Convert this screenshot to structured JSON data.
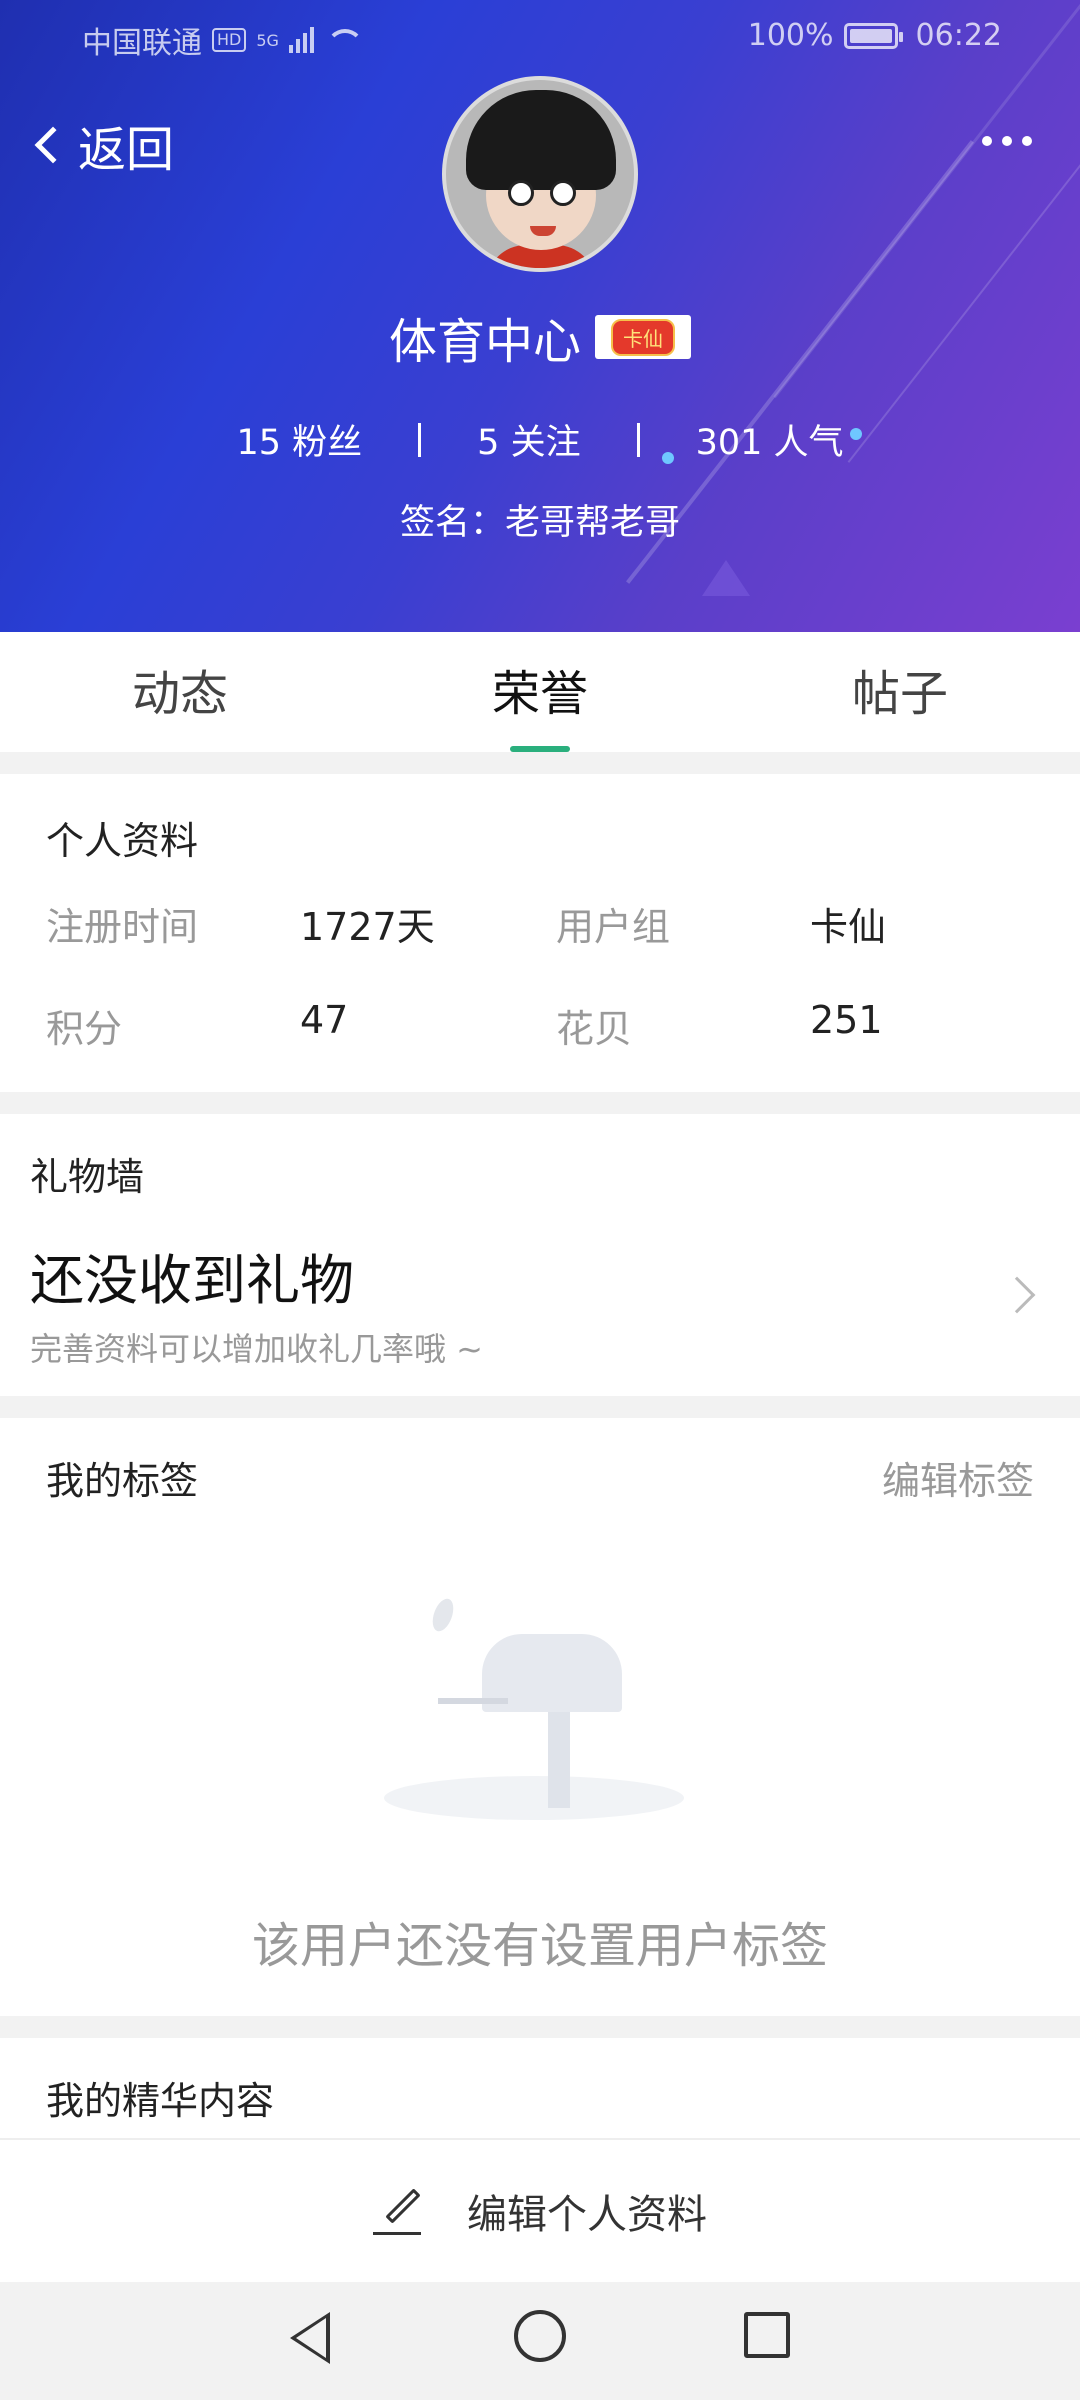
{
  "status_bar": {
    "carrier": "中国联通",
    "hd": "HD",
    "network": "5G",
    "battery": "100%",
    "time": "06:22"
  },
  "header": {
    "back_label": "返回",
    "username": "体育中心",
    "badge": "卡仙",
    "stats": [
      {
        "value": "15",
        "label": "粉丝"
      },
      {
        "value": "5",
        "label": "关注"
      },
      {
        "value": "301",
        "label": "人气"
      }
    ],
    "signature_label": "签名：",
    "signature": "老哥帮老哥",
    "accent_color": "#2a3fd6"
  },
  "tabs": [
    {
      "label": "动态",
      "active": false
    },
    {
      "label": "荣誉",
      "active": true
    },
    {
      "label": "帖子",
      "active": false
    }
  ],
  "profile": {
    "title": "个人资料",
    "fields": [
      {
        "label": "注册时间",
        "value": "1727天"
      },
      {
        "label": "用户组",
        "value": "卡仙"
      },
      {
        "label": "积分",
        "value": "47"
      },
      {
        "label": "花贝",
        "value": "251"
      }
    ]
  },
  "gift_wall": {
    "title": "礼物墙",
    "empty_title": "还没收到礼物",
    "hint": "完善资料可以增加收礼几率哦 ~"
  },
  "tags": {
    "title": "我的标签",
    "edit_label": "编辑标签",
    "empty_text": "该用户还没有设置用户标签"
  },
  "essence": {
    "title": "我的精华内容"
  },
  "bottom_action": {
    "label": "编辑个人资料"
  },
  "tab_accent_color": "#2aaf7d"
}
